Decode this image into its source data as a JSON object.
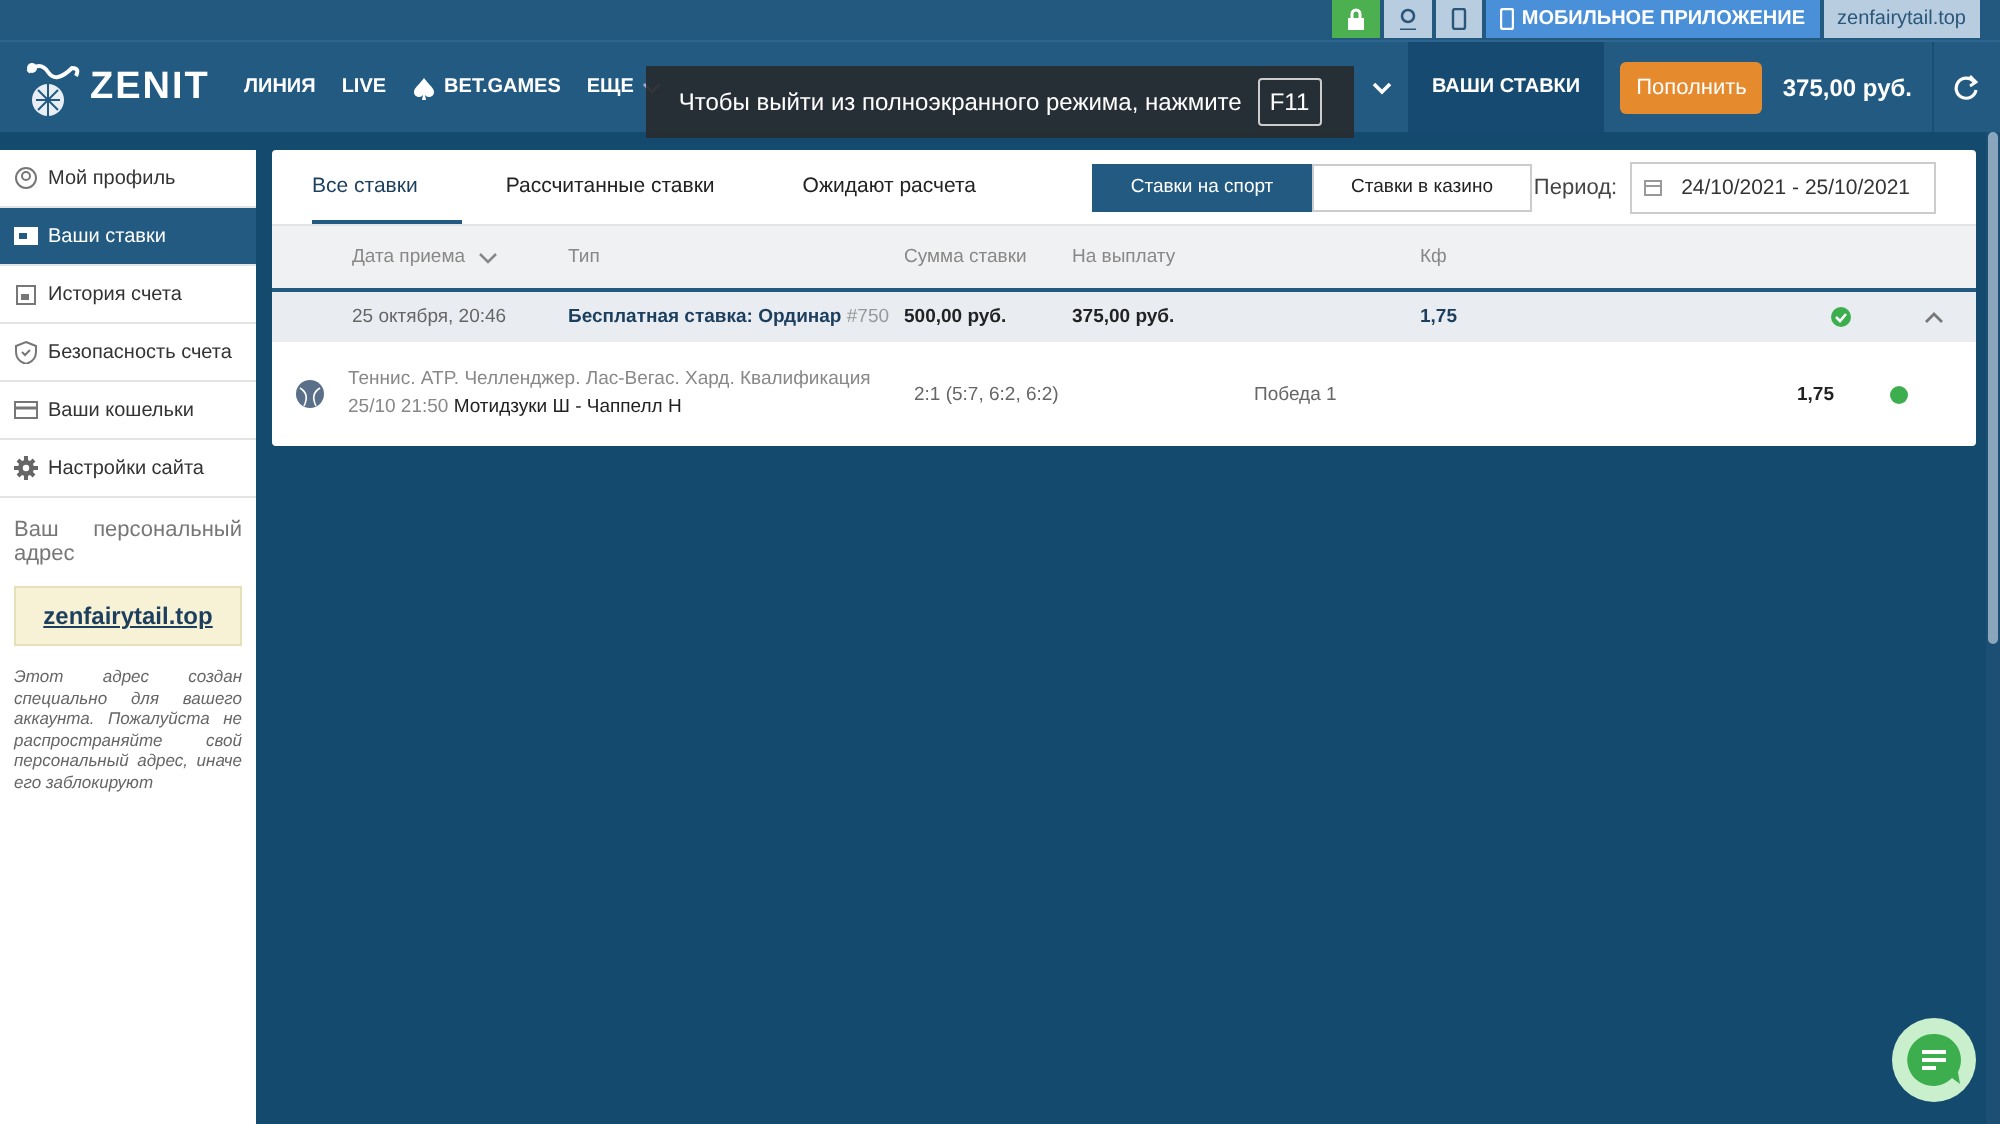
{
  "top_bar": {
    "buttons": [
      {
        "kind": "lock"
      },
      {
        "kind": "user"
      },
      {
        "kind": "phone"
      },
      {
        "kind": "app",
        "label": "МОБИЛЬНОЕ ПРИЛОЖЕНИЕ"
      },
      {
        "kind": "site",
        "label": "zenfairytail.top"
      }
    ]
  },
  "header": {
    "logo": "ZENIT",
    "nav": [
      {
        "label": "ЛИНИЯ",
        "kind": "plain"
      },
      {
        "label": "LIVE",
        "kind": "plain"
      },
      {
        "label": "BET.GAMES",
        "kind": "spade"
      },
      {
        "label": "ЕЩЕ",
        "kind": "more"
      }
    ],
    "my_bets": "ВАШИ СТАВКИ",
    "deposit": "Пополнить",
    "balance": "375,00 руб."
  },
  "fullscreen_notice": {
    "text": "Чтобы выйти из полноэкранного режима, нажмите",
    "key": "F11"
  },
  "sidebar": {
    "items": [
      {
        "label": "Мой профиль",
        "selected": false
      },
      {
        "label": "Ваши ставки",
        "selected": true
      },
      {
        "label": "История счета",
        "selected": false
      },
      {
        "label": "Безопасность счета",
        "selected": false
      },
      {
        "label": "Ваши кошельки",
        "selected": false
      },
      {
        "label": "Настройки сайта",
        "selected": false
      }
    ],
    "address_title": "Ваш персональный адрес",
    "address": "zenfairytail.top",
    "address_note": "Этот адрес создан специально для вашего аккаунта. Пожалуйста не распространяйте свой персональный адрес, иначе его заблокируют"
  },
  "tabs": [
    {
      "label": "Все ставки",
      "selected": true
    },
    {
      "label": "Рассчитанные ставки",
      "selected": false
    },
    {
      "label": "Ожидают расчета",
      "selected": false
    }
  ],
  "toggle": [
    {
      "label": "Ставки на спорт",
      "selected": true
    },
    {
      "label": "Ставки в казино",
      "selected": false
    }
  ],
  "period": {
    "label": "Период:",
    "value": "24/10/2021 - 25/10/2021"
  },
  "table": {
    "columns": [
      "Дата приема",
      "Тип",
      "Сумма ставки",
      "На выплату",
      "Кф"
    ],
    "bet": {
      "date": "25 октября, 20:46",
      "type": "Бесплатная ставка: Ординар",
      "number": "#750",
      "stake": "500,00 руб.",
      "payout": "375,00 руб.",
      "odds": "1,75",
      "won": true,
      "expanded": true
    },
    "event": {
      "league": "Теннис. ATP. Челленджер. Лас-Вегас. Хард. Квалификация",
      "time": "25/10 21:50",
      "teams": "Мотидзуки Ш - Чаппелл Н",
      "score": "2:1 (5:7, 6:2, 6:2)",
      "outcome": "Победа 1",
      "odds": "1,75",
      "won": true
    }
  }
}
